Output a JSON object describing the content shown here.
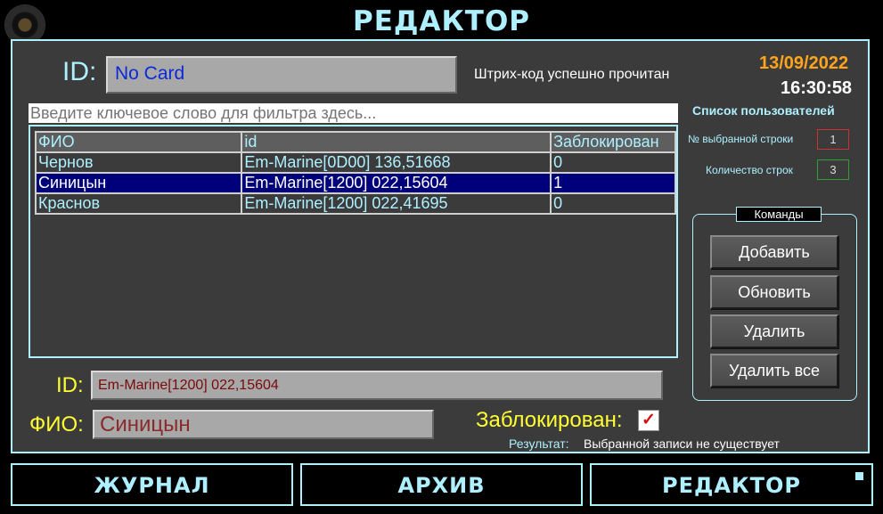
{
  "header": {
    "title": "РЕДАКТОР"
  },
  "card": {
    "id_label": "ID:",
    "id_value": "No Card",
    "scan_status": "Штрих-код успешно прочитан"
  },
  "clock": {
    "date": "13/09/2022",
    "time": "16:30:58"
  },
  "filter": {
    "placeholder": "Введите ключевое слово для фильтра здесь..."
  },
  "users_list": {
    "title": "Список пользователей",
    "selected_row_label": "№ выбранной строки",
    "selected_row_value": "1",
    "row_count_label": "Количество строк",
    "row_count_value": "3"
  },
  "table": {
    "columns": [
      "ФИО",
      "id",
      "Заблокирован"
    ],
    "selected_index": 1,
    "rows": [
      {
        "fio": "Чернов",
        "id": "Em-Marine[0D00] 136,51668",
        "blocked": "0"
      },
      {
        "fio": "Синицын",
        "id": "Em-Marine[1200] 022,15604",
        "blocked": "1"
      },
      {
        "fio": "Краснов",
        "id": "Em-Marine[1200] 022,41695",
        "blocked": "0"
      }
    ]
  },
  "commands": {
    "title": "Команды",
    "add": "Добавить",
    "refresh": "Обновить",
    "delete": "Удалить",
    "delete_all": "Удалить все"
  },
  "detail": {
    "id_label": "ID:",
    "id_value": "Em-Marine[1200] 022,15604",
    "fio_label": "ФИО:",
    "fio_value": "Синицын",
    "blocked_label": "Заблокирован:",
    "blocked_checked": true,
    "blocked_check_glyph": "✓",
    "result_label": "Результат:",
    "result_text": "Выбранной записи не существует"
  },
  "nav": {
    "journal": "ЖУРНАЛ",
    "archive": "АРХИВ",
    "editor": "РЕДАКТОР"
  },
  "colors": {
    "accent": "#aef0ff",
    "panel": "#3b3b3b",
    "selected_row": "#00007a",
    "date": "#ffa41c",
    "label_yellow": "#ffff33"
  }
}
